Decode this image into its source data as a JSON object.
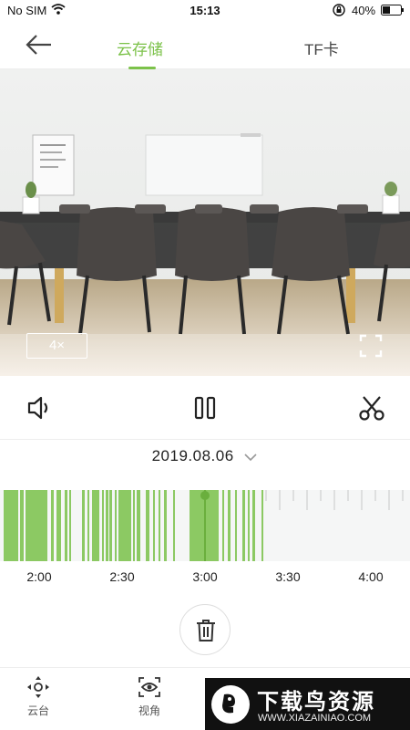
{
  "status_bar": {
    "carrier": "No SIM",
    "time": "15:13",
    "battery": "40%"
  },
  "nav": {
    "tabs": [
      {
        "label": "云存储",
        "active": true
      },
      {
        "label": "TF卡",
        "active": false
      }
    ]
  },
  "video": {
    "speed": "4×"
  },
  "date": {
    "value": "2019.08.06"
  },
  "timeline": {
    "ticks": [
      "2:00",
      "2:30",
      "3:00",
      "3:30",
      "4:00"
    ],
    "playhead_time": "3:00",
    "recorded_color": "#8cc963"
  },
  "bottom_nav": {
    "items": [
      {
        "label": "云台",
        "icon": "ptz-icon"
      },
      {
        "label": "视角",
        "icon": "view-angle-icon"
      }
    ]
  },
  "watermark": {
    "title": "下载鸟资源",
    "url": "WWW.XIAZAINIAO.COM"
  },
  "colors": {
    "accent": "#7cc24a"
  }
}
